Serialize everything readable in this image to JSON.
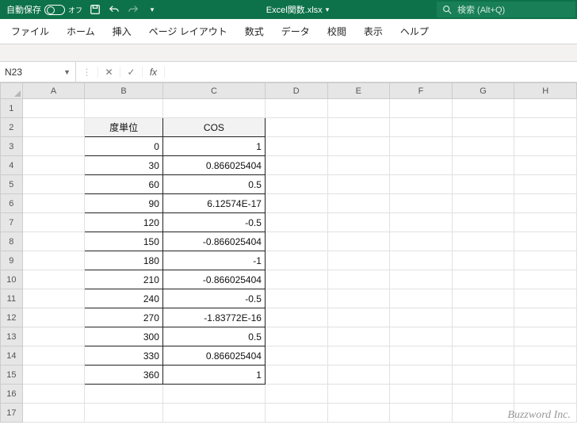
{
  "titlebar": {
    "autosave_label": "自動保存",
    "autosave_state": "オフ",
    "document_name": "Excel関数.xlsx",
    "search_placeholder": "検索 (Alt+Q)"
  },
  "ribbon": {
    "tabs": [
      "ファイル",
      "ホーム",
      "挿入",
      "ページ レイアウト",
      "数式",
      "データ",
      "校閲",
      "表示",
      "ヘルプ"
    ]
  },
  "formula_bar": {
    "namebox": "N23",
    "formula": ""
  },
  "grid": {
    "columns": [
      "A",
      "B",
      "C",
      "D",
      "E",
      "F",
      "G",
      "H"
    ],
    "row_count": 17,
    "headers": {
      "B": "度単位",
      "C": "COS"
    },
    "rows": [
      {
        "r": 3,
        "B": "0",
        "C": "1"
      },
      {
        "r": 4,
        "B": "30",
        "C": "0.866025404"
      },
      {
        "r": 5,
        "B": "60",
        "C": "0.5"
      },
      {
        "r": 6,
        "B": "90",
        "C": "6.12574E-17"
      },
      {
        "r": 7,
        "B": "120",
        "C": "-0.5"
      },
      {
        "r": 8,
        "B": "150",
        "C": "-0.866025404"
      },
      {
        "r": 9,
        "B": "180",
        "C": "-1"
      },
      {
        "r": 10,
        "B": "210",
        "C": "-0.866025404"
      },
      {
        "r": 11,
        "B": "240",
        "C": "-0.5"
      },
      {
        "r": 12,
        "B": "270",
        "C": "-1.83772E-16"
      },
      {
        "r": 13,
        "B": "300",
        "C": "0.5"
      },
      {
        "r": 14,
        "B": "330",
        "C": "0.866025404"
      },
      {
        "r": 15,
        "B": "360",
        "C": "1"
      }
    ]
  },
  "watermark": "Buzzword Inc.",
  "chart_data": {
    "type": "table",
    "title": "COS values by degree",
    "columns": [
      "度単位",
      "COS"
    ],
    "rows": [
      [
        0,
        1
      ],
      [
        30,
        0.866025404
      ],
      [
        60,
        0.5
      ],
      [
        90,
        6.12574e-17
      ],
      [
        120,
        -0.5
      ],
      [
        150,
        -0.866025404
      ],
      [
        180,
        -1
      ],
      [
        210,
        -0.866025404
      ],
      [
        240,
        -0.5
      ],
      [
        270,
        -1.83772e-16
      ],
      [
        300,
        0.5
      ],
      [
        330,
        0.866025404
      ],
      [
        360,
        1
      ]
    ]
  }
}
